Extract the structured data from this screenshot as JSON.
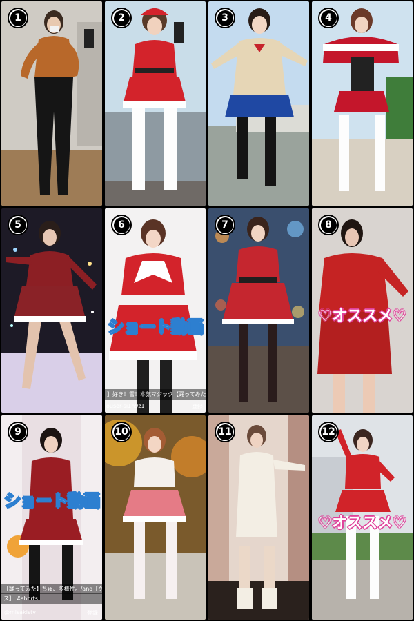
{
  "tiles": [
    {
      "number": "1"
    },
    {
      "number": "2"
    },
    {
      "number": "3"
    },
    {
      "number": "4"
    },
    {
      "number": "5"
    },
    {
      "number": "6",
      "overlay_text": "ショート動画",
      "caption": "】好き！雪！本気マジック【踊ってみた",
      "username": "ouser-si1h9z1",
      "subscribe_label": "登録"
    },
    {
      "number": "7"
    },
    {
      "number": "8",
      "overlay_text": "♡オススメ♡"
    },
    {
      "number": "9",
      "overlay_text": "ショート動画",
      "caption_line1": "【踊ってみた】ちゅ、多様性。/ano【グロチ",
      "caption_line2": "ス】 #shorts",
      "username": "@misakistv",
      "subscribe_label": "登録"
    },
    {
      "number": "10"
    },
    {
      "number": "11"
    },
    {
      "number": "12",
      "overlay_text": "♡オススメ♡"
    }
  ]
}
